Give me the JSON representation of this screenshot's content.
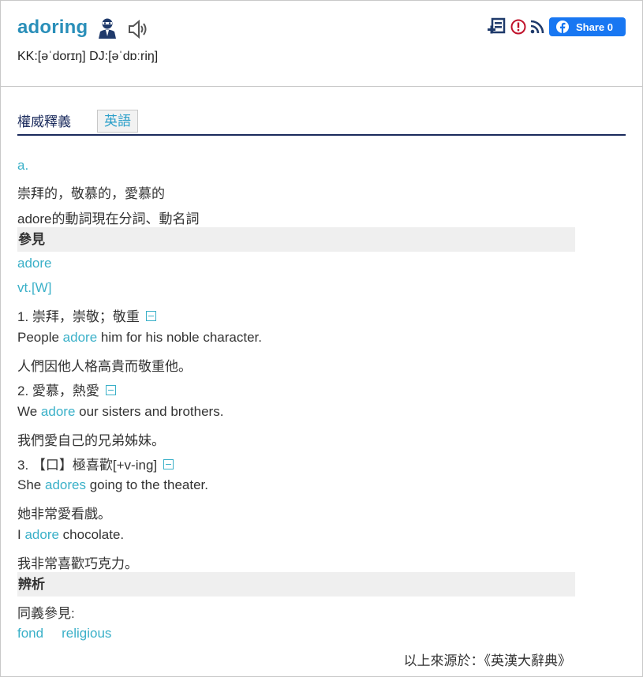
{
  "header": {
    "word": "adoring",
    "pronunciation": "KK:[əˈdorɪŋ] DJ:[əˈdɒːriŋ]",
    "share_label": "Share 0"
  },
  "tabs": [
    {
      "label": "權威釋義"
    },
    {
      "label": "英語"
    }
  ],
  "entry": {
    "pos_a": "a.",
    "meaning_a": "崇拜的，敬慕的，愛慕的",
    "meaning_b": "adore的動詞現在分詞、動名詞",
    "section_see": "參見",
    "see_word": "adore",
    "pos_vt": "vt.[W]",
    "senses": [
      {
        "label": "1. 崇拜，崇敬；敬重",
        "examples": [
          {
            "pre": "People ",
            "hit": "adore",
            "post": " him for his noble character.",
            "zh": "人們因他人格高貴而敬重他。"
          }
        ]
      },
      {
        "label": "2. 愛慕，熱愛",
        "examples": [
          {
            "pre": "We ",
            "hit": "adore",
            "post": " our sisters and brothers.",
            "zh": "我們愛自己的兄弟姊妹。"
          }
        ]
      },
      {
        "label": "3. 【口】極喜歡[+v-ing]",
        "examples": [
          {
            "pre": "She ",
            "hit": "adores",
            "post": " going to the theater.",
            "zh": "她非常愛看戲。"
          },
          {
            "pre": "I ",
            "hit": "adore",
            "post": " chocolate.",
            "zh": "我非常喜歡巧克力。"
          }
        ]
      }
    ],
    "section_analysis": "辨析",
    "synonyms_label": "同義參見:",
    "synonyms": [
      "fond",
      "religious"
    ],
    "source": "以上來源於：《英漢大辭典》"
  },
  "colors": {
    "word": "#2a8fb9",
    "link": "#3ab0c8",
    "tab_rule": "#1a2a5c",
    "facebook": "#1877f2"
  },
  "icons": [
    "person-icon",
    "speaker-icon",
    "add-to-list-icon",
    "report-icon",
    "rss-icon",
    "facebook-icon",
    "collapse-icon"
  ]
}
